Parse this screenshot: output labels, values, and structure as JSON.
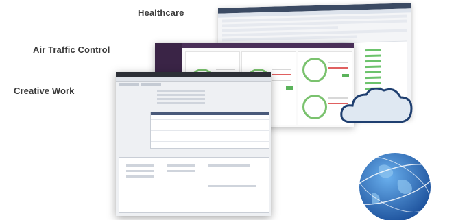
{
  "labels": {
    "healthcare": "Healthcare",
    "air_traffic": "Air Traffic Control",
    "creative": "Creative Work"
  },
  "colors": {
    "label_text": "#3a3a3a",
    "globe_blue": "#2a6fc4",
    "cloud": "#dfe8f2"
  },
  "icons": [
    "cloud-icon",
    "globe-icon"
  ]
}
